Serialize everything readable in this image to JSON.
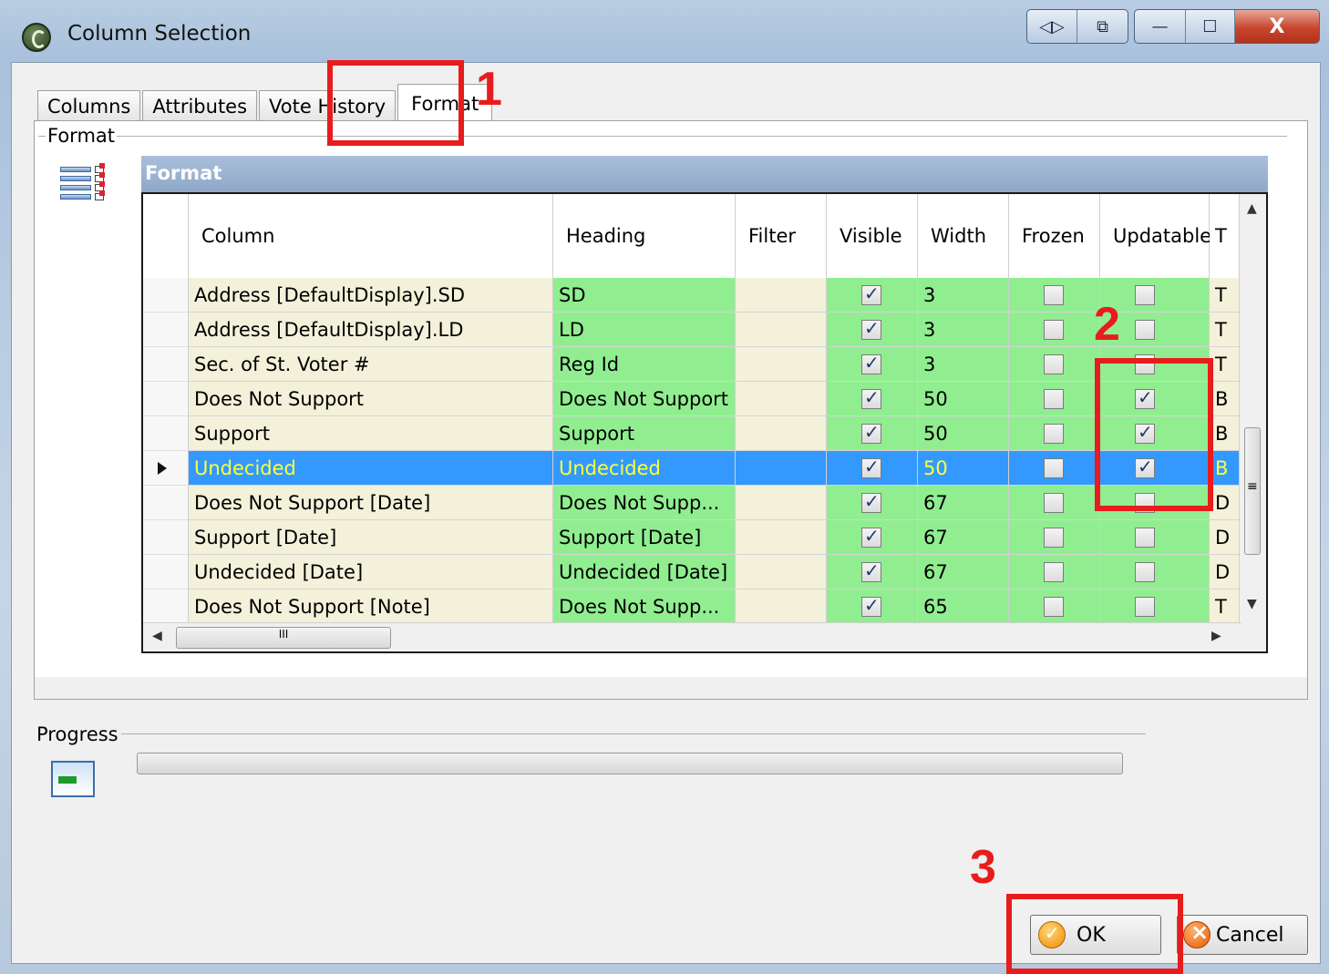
{
  "window": {
    "title": "Column Selection",
    "buttons": [
      "◁▷",
      "⧉",
      "—",
      "☐",
      "X"
    ]
  },
  "tabs": [
    {
      "label": "Columns",
      "active": false
    },
    {
      "label": "Attributes",
      "active": false
    },
    {
      "label": "Vote History",
      "active": false
    },
    {
      "label": "Format",
      "active": true
    }
  ],
  "format_group": {
    "legend": "Format",
    "grid_title": "Format",
    "columns": [
      "Column",
      "Heading",
      "Filter",
      "Visible",
      "Width",
      "Frozen",
      "Updatable",
      "T"
    ],
    "rows": [
      {
        "column": "Address [DefaultDisplay].SD",
        "heading": "SD",
        "filter": "",
        "visible": true,
        "width": "3",
        "frozen": false,
        "updatable": false,
        "type": "T",
        "selected": false
      },
      {
        "column": "Address [DefaultDisplay].LD",
        "heading": "LD",
        "filter": "",
        "visible": true,
        "width": "3",
        "frozen": false,
        "updatable": false,
        "type": "T",
        "selected": false
      },
      {
        "column": "Sec. of St. Voter #",
        "heading": "Reg Id",
        "filter": "",
        "visible": true,
        "width": "3",
        "frozen": false,
        "updatable": false,
        "type": "T",
        "selected": false
      },
      {
        "column": "Does Not Support",
        "heading": "Does Not Support",
        "filter": "",
        "visible": true,
        "width": "50",
        "frozen": false,
        "updatable": true,
        "type": "B",
        "selected": false
      },
      {
        "column": "Support",
        "heading": "Support",
        "filter": "",
        "visible": true,
        "width": "50",
        "frozen": false,
        "updatable": true,
        "type": "B",
        "selected": false
      },
      {
        "column": "Undecided",
        "heading": "Undecided",
        "filter": "",
        "visible": true,
        "width": "50",
        "frozen": false,
        "updatable": true,
        "type": "B",
        "selected": true
      },
      {
        "column": "Does Not Support [Date]",
        "heading": "Does Not Supp...",
        "filter": "",
        "visible": true,
        "width": "67",
        "frozen": false,
        "updatable": false,
        "type": "D",
        "selected": false
      },
      {
        "column": "Support [Date]",
        "heading": "Support [Date]",
        "filter": "",
        "visible": true,
        "width": "67",
        "frozen": false,
        "updatable": false,
        "type": "D",
        "selected": false
      },
      {
        "column": "Undecided [Date]",
        "heading": "Undecided [Date]",
        "filter": "",
        "visible": true,
        "width": "67",
        "frozen": false,
        "updatable": false,
        "type": "D",
        "selected": false
      },
      {
        "column": "Does Not Support [Note]",
        "heading": "Does Not Supp...",
        "filter": "",
        "visible": true,
        "width": "65",
        "frozen": false,
        "updatable": false,
        "type": "T",
        "selected": false
      }
    ],
    "hscroll_grip": "III",
    "vscroll_grip": "≡"
  },
  "progress": {
    "legend": "Progress",
    "value": 0
  },
  "buttons": {
    "ok": "OK",
    "cancel": "Cancel"
  },
  "annotations": {
    "step1": "1",
    "step2": "2",
    "step3": "3",
    "color": "#e81c1c"
  },
  "colors": {
    "selected_row": "#3399ff",
    "selected_text": "#ffff33",
    "heading_cell": "#90ee90",
    "column_cell": "#f4f1da"
  }
}
